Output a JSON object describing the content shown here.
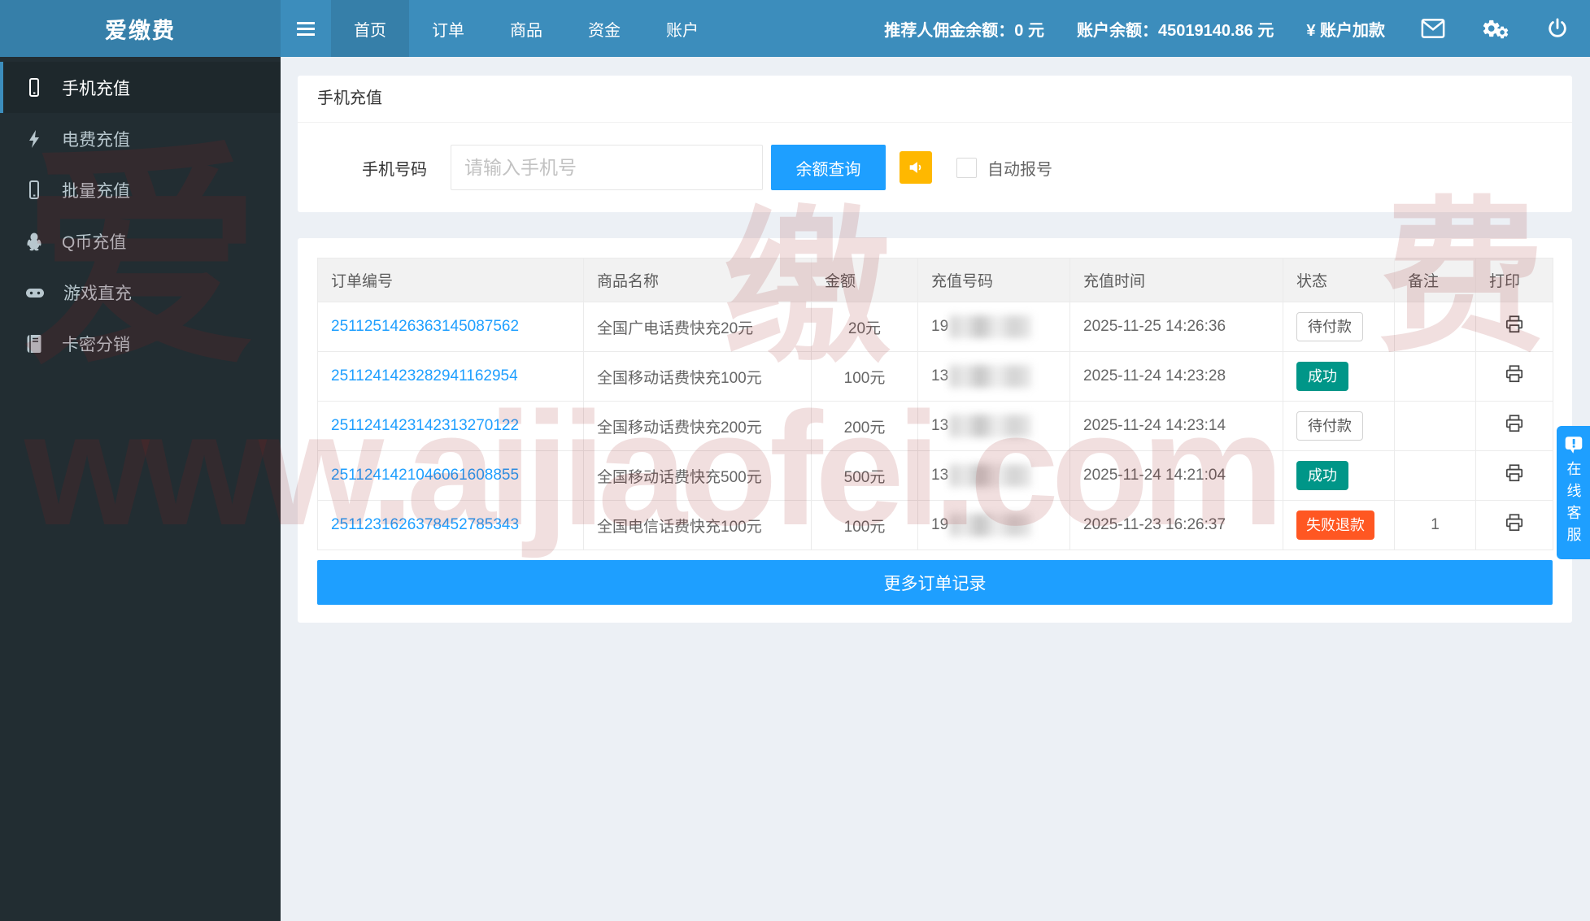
{
  "brand": {
    "logo": "爱缴费"
  },
  "navbar": {
    "menu": [
      "首页",
      "订单",
      "商品",
      "资金",
      "账户"
    ],
    "commission_label": "推荐人佣金余额：",
    "commission_value": "0 元",
    "balance_label": "账户余额：",
    "balance_value": "45019140.86 元",
    "topup_label": "¥ 账户加款"
  },
  "sidebar": {
    "items": [
      {
        "label": "手机充值"
      },
      {
        "label": "电费充值"
      },
      {
        "label": "批量充值"
      },
      {
        "label": "Q币充值"
      },
      {
        "label": "游戏直充"
      },
      {
        "label": "卡密分销"
      }
    ]
  },
  "recharge_panel": {
    "title": "手机充值",
    "phone_label": "手机号码",
    "phone_placeholder": "请输入手机号",
    "query_button": "余额查询",
    "auto_checkbox_label": "自动报号"
  },
  "orders_table": {
    "headers": [
      "订单编号",
      "商品名称",
      "金额",
      "充值号码",
      "充值时间",
      "状态",
      "备注",
      "打印"
    ],
    "rows": [
      {
        "order_id": "2511251426363145087562",
        "product": "全国广电话费快充20元",
        "amount": "20元",
        "phone_prefix": "19",
        "time": "2025-11-25 14:26:36",
        "status": "待付款",
        "status_type": "pending",
        "remark": ""
      },
      {
        "order_id": "2511241423282941162954",
        "product": "全国移动话费快充100元",
        "amount": "100元",
        "phone_prefix": "13",
        "time": "2025-11-24 14:23:28",
        "status": "成功",
        "status_type": "success",
        "remark": ""
      },
      {
        "order_id": "2511241423142313270122",
        "product": "全国移动话费快充200元",
        "amount": "200元",
        "phone_prefix": "13",
        "time": "2025-11-24 14:23:14",
        "status": "待付款",
        "status_type": "pending",
        "remark": ""
      },
      {
        "order_id": "2511241421046061608855",
        "product": "全国移动话费快充500元",
        "amount": "500元",
        "phone_prefix": "13",
        "time": "2025-11-24 14:21:04",
        "status": "成功",
        "status_type": "success",
        "remark": ""
      },
      {
        "order_id": "2511231626378452785343",
        "product": "全国电信话费快充100元",
        "amount": "100元",
        "phone_prefix": "19",
        "time": "2025-11-23 16:26:37",
        "status": "失败退款",
        "status_type": "failed",
        "remark": "1"
      }
    ],
    "more_button": "更多订单记录"
  },
  "service_widget": {
    "label": "在线客服"
  },
  "watermark": {
    "url": "www.aijiaofei.com",
    "chars": [
      "爱",
      "缴",
      "费"
    ]
  },
  "colors": {
    "navbar_blue": "#3c8dbc",
    "navbar_dark_blue": "#367fa9",
    "sidebar_dark": "#222d32",
    "accent_blue": "#1E9FFF",
    "sound_orange": "#FFB800",
    "success_green": "#009688",
    "fail_red": "#FF5722"
  }
}
